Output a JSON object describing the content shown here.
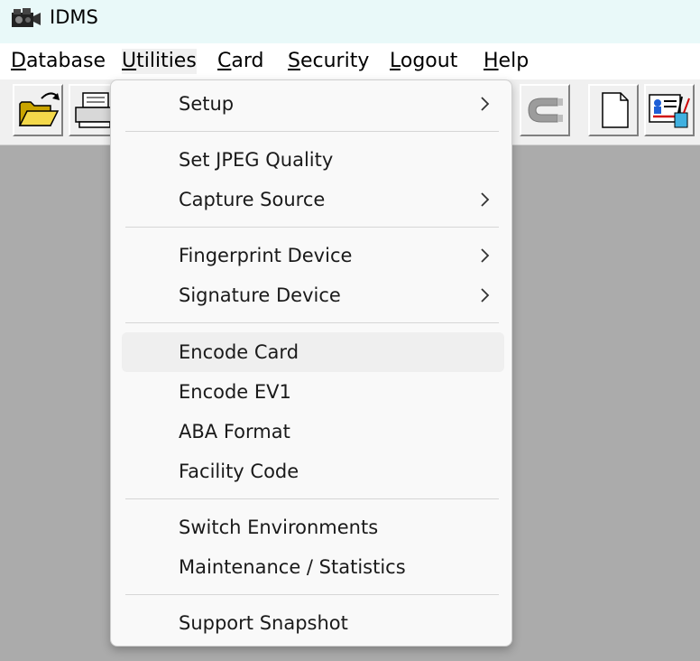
{
  "window": {
    "title": "IDMS",
    "app_icon": "film-camera-icon"
  },
  "menubar": {
    "items": [
      {
        "label": "Database",
        "mnemonic": "D",
        "rest": "atabase"
      },
      {
        "label": "Utilities",
        "mnemonic": "U",
        "rest": "tilities"
      },
      {
        "label": "Card",
        "mnemonic": "C",
        "rest": "ard"
      },
      {
        "label": "Security",
        "mnemonic": "S",
        "rest": "ecurity"
      },
      {
        "label": "Logout",
        "mnemonic": "L",
        "rest": "ogout"
      },
      {
        "label": "Help",
        "mnemonic": "H",
        "rest": "elp"
      }
    ],
    "open_menu": "Utilities"
  },
  "toolbar": {
    "buttons": [
      {
        "icon": "open-folder-icon"
      },
      {
        "icon": "printer-icon"
      },
      {
        "icon": "magnet-icon"
      },
      {
        "icon": "new-document-icon"
      },
      {
        "icon": "card-design-icon"
      }
    ]
  },
  "utilities_menu": {
    "items": [
      {
        "label": "Setup",
        "submenu": true
      },
      {
        "label": "Set JPEG Quality",
        "submenu": false
      },
      {
        "label": "Capture Source",
        "submenu": true
      },
      {
        "label": "Fingerprint Device",
        "submenu": true
      },
      {
        "label": "Signature Device",
        "submenu": true
      },
      {
        "label": "Encode Card",
        "submenu": false,
        "highlighted": true
      },
      {
        "label": "Encode EV1",
        "submenu": false
      },
      {
        "label": "ABA Format",
        "submenu": false
      },
      {
        "label": "Facility Code",
        "submenu": false
      },
      {
        "label": "Switch Environments",
        "submenu": false
      },
      {
        "label": "Maintenance / Statistics",
        "submenu": false
      },
      {
        "label": "Support Snapshot",
        "submenu": false
      }
    ]
  },
  "colors": {
    "titlebar_bg": "#e9f9f9",
    "workspace_bg": "#ababab",
    "menu_bg": "#f9f9f9",
    "hover_bg": "#efefef"
  }
}
